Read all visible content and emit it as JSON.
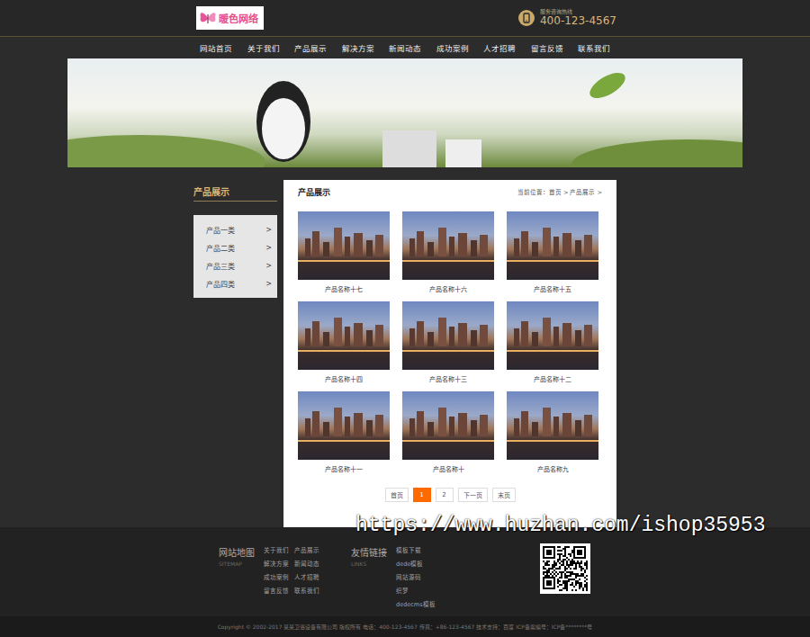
{
  "logo": {
    "text": "暖色网络"
  },
  "hotline": {
    "label": "服务咨询热线",
    "number": "400-123-4567"
  },
  "nav": [
    {
      "label": "网站首页",
      "selected": false
    },
    {
      "label": "关于我们",
      "selected": false
    },
    {
      "label": "产品展示",
      "selected": false
    },
    {
      "label": "解决方案",
      "selected": false
    },
    {
      "label": "新闻动态",
      "selected": false
    },
    {
      "label": "成功案例",
      "selected": false
    },
    {
      "label": "人才招聘",
      "selected": false
    },
    {
      "label": "留言反馈",
      "selected": false
    },
    {
      "label": "联系我们",
      "selected": false
    }
  ],
  "sidebar": {
    "title": "产品展示",
    "items": [
      {
        "label": "产品一类",
        "arrow": ">"
      },
      {
        "label": "产品二类",
        "arrow": ">"
      },
      {
        "label": "产品三类",
        "arrow": ">"
      },
      {
        "label": "产品四类",
        "arrow": ">"
      }
    ]
  },
  "panel": {
    "title": "产品展示",
    "breadcrumb": "当前位置：首页 > 产品展示 >",
    "products": [
      {
        "name": "产品名称十七"
      },
      {
        "name": "产品名称十六"
      },
      {
        "name": "产品名称十五"
      },
      {
        "name": "产品名称十四"
      },
      {
        "name": "产品名称十三"
      },
      {
        "name": "产品名称十二"
      },
      {
        "name": "产品名称十一"
      },
      {
        "name": "产品名称十"
      },
      {
        "name": "产品名称九"
      }
    ]
  },
  "pagination": [
    {
      "label": "首页",
      "selected": false
    },
    {
      "label": "1",
      "selected": true
    },
    {
      "label": "2",
      "selected": false
    },
    {
      "label": "下一页",
      "selected": false
    },
    {
      "label": "末页",
      "selected": false
    }
  ],
  "footer": {
    "sitemap": {
      "title": "网站地图",
      "subtitle": "SITEMAP",
      "links": [
        "关于我们",
        "产品展示",
        "解决方案",
        "新闻动态",
        "成功案例",
        "人才招聘",
        "留言反馈",
        "联系我们"
      ]
    },
    "friends": {
      "title": "友情链接",
      "subtitle": "LINKS",
      "links": [
        "模板下载",
        "dede模板",
        "网站源码",
        "织梦",
        "dedecms模板"
      ]
    }
  },
  "copyright": "Copyright © 2002-2017 某某卫浴设备有限公司 版权所有    电话：400-123-4567    传真：+86-123-4567    技术支持：百度    ICP备案编号：ICP备********号",
  "watermark": "https://www.huzhan.com/ishop35953"
}
